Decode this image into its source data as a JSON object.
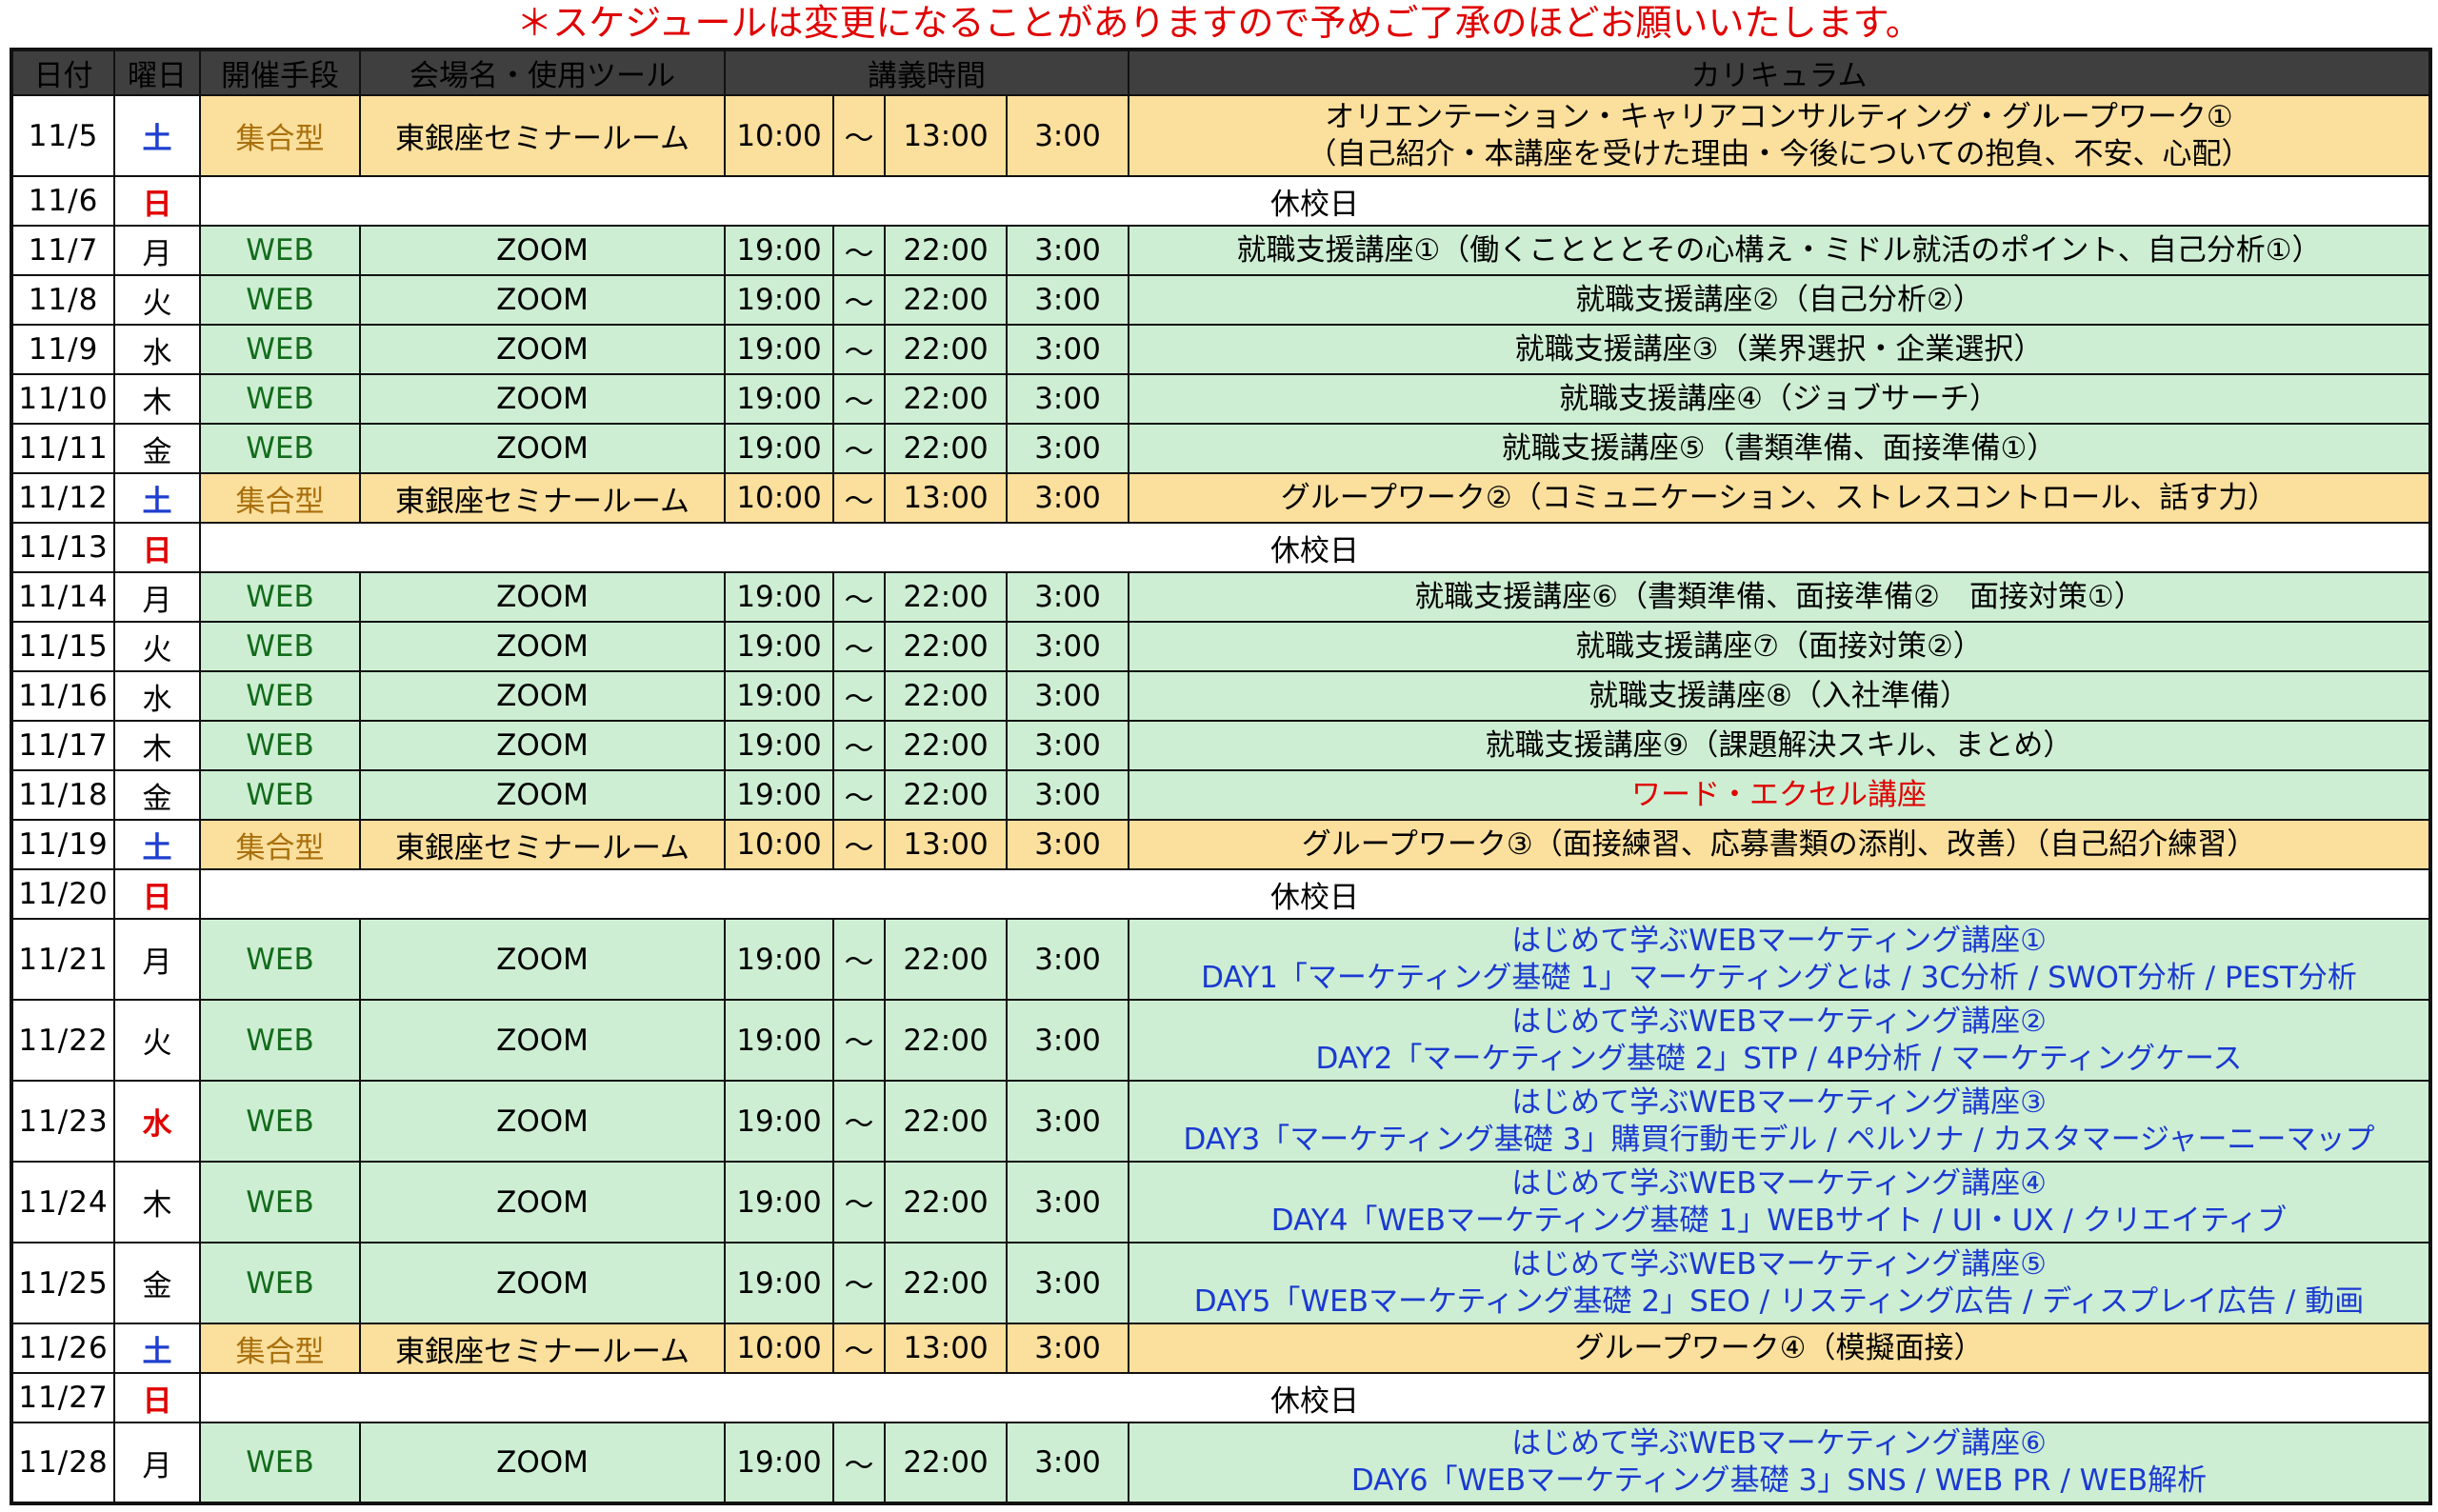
{
  "notice": "＊スケジュールは変更になることがありますので予めご了承のほどお願いいたします。",
  "headers": {
    "date": "日付",
    "weekday": "曜日",
    "method": "開催手段",
    "venue": "会場名・使用ツール",
    "time": "講義時間",
    "curriculum": "カリキュラム"
  },
  "colors": {
    "web_row": "#cdeed3",
    "group_row": "#fbdf9c",
    "header": "#3f3f3f",
    "saturday": "#1e3fcf",
    "sunday_holiday": "#e00000",
    "marketing_text": "#1a3ad1"
  },
  "rows": [
    {
      "date": "11/5",
      "wd": "土",
      "method": "集合型",
      "venue": "東銀座セミナールーム",
      "start": "10:00",
      "sep": "～",
      "end": "13:00",
      "dur": "3:00",
      "cur1": "オリエンテーション・キャリアコンサルティング・グループワーク①",
      "cur2": "（自己紹介・本講座を受けた理由・今後についての抱負、不安、心配）"
    },
    {
      "date": "11/6",
      "wd": "日",
      "rest": "休校日"
    },
    {
      "date": "11/7",
      "wd": "月",
      "method": "WEB",
      "venue": "ZOOM",
      "start": "19:00",
      "sep": "～",
      "end": "22:00",
      "dur": "3:00",
      "cur1": "就職支援講座①（働くことととその心構え・ミドル就活のポイント、自己分析①）"
    },
    {
      "date": "11/8",
      "wd": "火",
      "method": "WEB",
      "venue": "ZOOM",
      "start": "19:00",
      "sep": "～",
      "end": "22:00",
      "dur": "3:00",
      "cur1": "就職支援講座②（自己分析②）"
    },
    {
      "date": "11/9",
      "wd": "水",
      "method": "WEB",
      "venue": "ZOOM",
      "start": "19:00",
      "sep": "～",
      "end": "22:00",
      "dur": "3:00",
      "cur1": "就職支援講座③（業界選択・企業選択）"
    },
    {
      "date": "11/10",
      "wd": "木",
      "method": "WEB",
      "venue": "ZOOM",
      "start": "19:00",
      "sep": "～",
      "end": "22:00",
      "dur": "3:00",
      "cur1": "就職支援講座④（ジョブサーチ）"
    },
    {
      "date": "11/11",
      "wd": "金",
      "method": "WEB",
      "venue": "ZOOM",
      "start": "19:00",
      "sep": "～",
      "end": "22:00",
      "dur": "3:00",
      "cur1": "就職支援講座⑤（書類準備、面接準備①）"
    },
    {
      "date": "11/12",
      "wd": "土",
      "method": "集合型",
      "venue": "東銀座セミナールーム",
      "start": "10:00",
      "sep": "～",
      "end": "13:00",
      "dur": "3:00",
      "cur1": "グループワーク②（コミュニケーション、ストレスコントロール、話す力）"
    },
    {
      "date": "11/13",
      "wd": "日",
      "rest": "休校日"
    },
    {
      "date": "11/14",
      "wd": "月",
      "method": "WEB",
      "venue": "ZOOM",
      "start": "19:00",
      "sep": "～",
      "end": "22:00",
      "dur": "3:00",
      "cur1": "就職支援講座⑥（書類準備、面接準備②　面接対策①）"
    },
    {
      "date": "11/15",
      "wd": "火",
      "method": "WEB",
      "venue": "ZOOM",
      "start": "19:00",
      "sep": "～",
      "end": "22:00",
      "dur": "3:00",
      "cur1": "就職支援講座⑦（面接対策②）"
    },
    {
      "date": "11/16",
      "wd": "水",
      "method": "WEB",
      "venue": "ZOOM",
      "start": "19:00",
      "sep": "～",
      "end": "22:00",
      "dur": "3:00",
      "cur1": "就職支援講座⑧（入社準備）"
    },
    {
      "date": "11/17",
      "wd": "木",
      "method": "WEB",
      "venue": "ZOOM",
      "start": "19:00",
      "sep": "～",
      "end": "22:00",
      "dur": "3:00",
      "cur1": "就職支援講座⑨（課題解決スキル、まとめ）"
    },
    {
      "date": "11/18",
      "wd": "金",
      "method": "WEB",
      "venue": "ZOOM",
      "start": "19:00",
      "sep": "～",
      "end": "22:00",
      "dur": "3:00",
      "cur1": "ワード・エクセル講座"
    },
    {
      "date": "11/19",
      "wd": "土",
      "method": "集合型",
      "venue": "東銀座セミナールーム",
      "start": "10:00",
      "sep": "～",
      "end": "13:00",
      "dur": "3:00",
      "cur1": "グループワーク③（面接練習、応募書類の添削、改善）（自己紹介練習）"
    },
    {
      "date": "11/20",
      "wd": "日",
      "rest": "休校日"
    },
    {
      "date": "11/21",
      "wd": "月",
      "method": "WEB",
      "venue": "ZOOM",
      "start": "19:00",
      "sep": "～",
      "end": "22:00",
      "dur": "3:00",
      "cur1": "はじめて学ぶWEBマーケティング講座①",
      "cur2": "DAY1「マーケティング基礎 1」マーケティングとは / 3C分析 / SWOT分析 / PEST分析"
    },
    {
      "date": "11/22",
      "wd": "火",
      "method": "WEB",
      "venue": "ZOOM",
      "start": "19:00",
      "sep": "～",
      "end": "22:00",
      "dur": "3:00",
      "cur1": "はじめて学ぶWEBマーケティング講座②",
      "cur2": "DAY2「マーケティング基礎 2」STP / 4P分析 / マーケティングケース"
    },
    {
      "date": "11/23",
      "wd": "水",
      "method": "WEB",
      "venue": "ZOOM",
      "start": "19:00",
      "sep": "～",
      "end": "22:00",
      "dur": "3:00",
      "cur1": "はじめて学ぶWEBマーケティング講座③",
      "cur2": "DAY3「マーケティング基礎 3」購買行動モデル / ペルソナ / カスタマージャーニーマップ"
    },
    {
      "date": "11/24",
      "wd": "木",
      "method": "WEB",
      "venue": "ZOOM",
      "start": "19:00",
      "sep": "～",
      "end": "22:00",
      "dur": "3:00",
      "cur1": "はじめて学ぶWEBマーケティング講座④",
      "cur2": "DAY4「WEBマーケティング基礎 1」WEBサイト / UI・UX / クリエイティブ"
    },
    {
      "date": "11/25",
      "wd": "金",
      "method": "WEB",
      "venue": "ZOOM",
      "start": "19:00",
      "sep": "～",
      "end": "22:00",
      "dur": "3:00",
      "cur1": "はじめて学ぶWEBマーケティング講座⑤",
      "cur2": "DAY5「WEBマーケティング基礎 2」SEO / リスティング広告 / ディスプレイ広告 / 動画"
    },
    {
      "date": "11/26",
      "wd": "土",
      "method": "集合型",
      "venue": "東銀座セミナールーム",
      "start": "10:00",
      "sep": "～",
      "end": "13:00",
      "dur": "3:00",
      "cur1": "グループワーク④（模擬面接）"
    },
    {
      "date": "11/27",
      "wd": "日",
      "rest": "休校日"
    },
    {
      "date": "11/28",
      "wd": "月",
      "method": "WEB",
      "venue": "ZOOM",
      "start": "19:00",
      "sep": "～",
      "end": "22:00",
      "dur": "3:00",
      "cur1": "はじめて学ぶWEBマーケティング講座⑥",
      "cur2": "DAY6「WEBマーケティング基礎 3」SNS / WEB PR / WEB解析"
    }
  ]
}
